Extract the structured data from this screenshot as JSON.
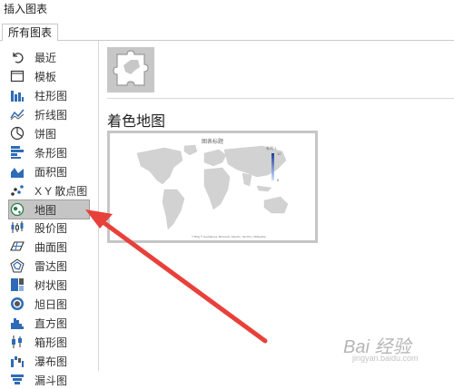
{
  "window": {
    "title": "插入图表"
  },
  "tabs": [
    {
      "label": "所有图表"
    }
  ],
  "sidebar": {
    "items": [
      {
        "label": "最近",
        "icon": "recent-icon"
      },
      {
        "label": "模板",
        "icon": "template-icon"
      },
      {
        "label": "柱形图",
        "icon": "column-chart-icon"
      },
      {
        "label": "折线图",
        "icon": "line-chart-icon"
      },
      {
        "label": "饼图",
        "icon": "pie-chart-icon"
      },
      {
        "label": "条形图",
        "icon": "bar-chart-icon"
      },
      {
        "label": "面积图",
        "icon": "area-chart-icon"
      },
      {
        "label": "X Y 散点图",
        "icon": "scatter-chart-icon"
      },
      {
        "label": "地图",
        "icon": "map-chart-icon",
        "selected": true
      },
      {
        "label": "股价图",
        "icon": "stock-chart-icon"
      },
      {
        "label": "曲面图",
        "icon": "surface-chart-icon"
      },
      {
        "label": "雷达图",
        "icon": "radar-chart-icon"
      },
      {
        "label": "树状图",
        "icon": "treemap-chart-icon"
      },
      {
        "label": "旭日图",
        "icon": "sunburst-chart-icon"
      },
      {
        "label": "直方图",
        "icon": "histogram-chart-icon"
      },
      {
        "label": "箱形图",
        "icon": "box-whisker-chart-icon"
      },
      {
        "label": "瀑布图",
        "icon": "waterfall-chart-icon"
      },
      {
        "label": "漏斗图",
        "icon": "funnel-chart-icon"
      }
    ]
  },
  "main": {
    "section_title": "着色地图",
    "preview": {
      "chart_title": "图表标题",
      "legend_title": "系列 1",
      "legend_max": "12",
      "legend_min": "6",
      "credit": "© Bing   © GeoNames, Microsoft, Navinfo, TomTom, Wikipedia"
    }
  },
  "colors": {
    "accent_red": "#e8403a",
    "selected_bg": "#c5c5c5",
    "map_gray": "#d2d2d2",
    "icon_blue": "#2e6bb5"
  },
  "watermark": {
    "text": "Bai 经验",
    "sub": "jingyan.baidu.com"
  }
}
